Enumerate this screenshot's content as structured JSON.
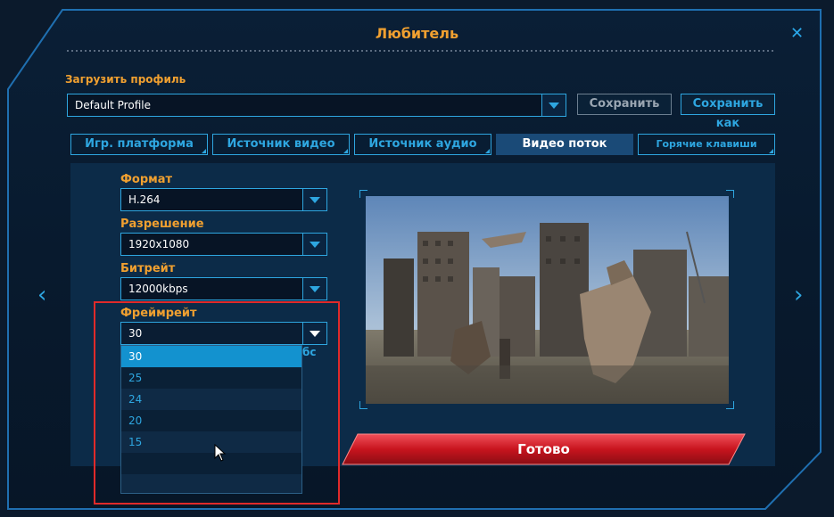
{
  "window": {
    "title": "Любитель",
    "close_label": "✕"
  },
  "profile": {
    "load_label": "Загрузить профиль",
    "selected": "Default Profile",
    "save_label": "Сохранить",
    "save_as_label": "Сохранить как"
  },
  "tabs": [
    {
      "label": "Игр. платформа"
    },
    {
      "label": "Источник видео"
    },
    {
      "label": "Источник аудио"
    },
    {
      "label": "Видео поток"
    },
    {
      "label": "Горячие клавиши"
    }
  ],
  "video": {
    "format_label": "Формат",
    "format_value": "H.264",
    "resolution_label": "Разрешение",
    "resolution_value": "1920x1080",
    "bitrate_label": "Битрейт",
    "bitrate_value": "12000kbps",
    "framerate_label": "Фреймрейт",
    "framerate_value": "30",
    "framerate_unit_partial": "бс",
    "framerate_options": [
      "30",
      "25",
      "24",
      "20",
      "15"
    ]
  },
  "done_label": "Готово",
  "nav": {
    "prev": "‹",
    "next": "›"
  },
  "colors": {
    "accent": "#2ea6e0",
    "title": "#f0a030",
    "done": "#d0202a",
    "highlight": "#e02a2a"
  }
}
